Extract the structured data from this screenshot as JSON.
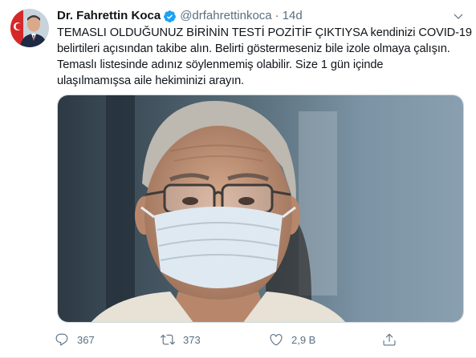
{
  "author": {
    "display_name": "Dr. Fahrettin Koca",
    "handle": "@drfahrettinkoca",
    "separator": "·",
    "timestamp": "14d",
    "verified": true
  },
  "tweet": {
    "lines": [
      "TEMASLI OLDUĞUNUZ BİRİNİN TESTİ POZİTİF ÇIKTIYSA kendinizi COVID-19",
      "belirtileri açısından takibe alın. Belirti göstermeseniz bile izole olmaya çalışın.",
      "Temaslı listesinde adınız söylenmemiş olabilir. Size 1 gün içinde",
      "ulaşılmamışsa aile hekiminizi arayın."
    ]
  },
  "actions": {
    "reply": {
      "icon": "reply-icon",
      "count": "367"
    },
    "retweet": {
      "icon": "retweet-icon",
      "count": "373"
    },
    "like": {
      "icon": "heart-icon",
      "count": "2,9 B"
    },
    "share": {
      "icon": "share-icon"
    }
  },
  "colors": {
    "text": "#0f1419",
    "secondary": "#5b7083",
    "verified": "#1da1f2",
    "border": "#cfd9de"
  }
}
